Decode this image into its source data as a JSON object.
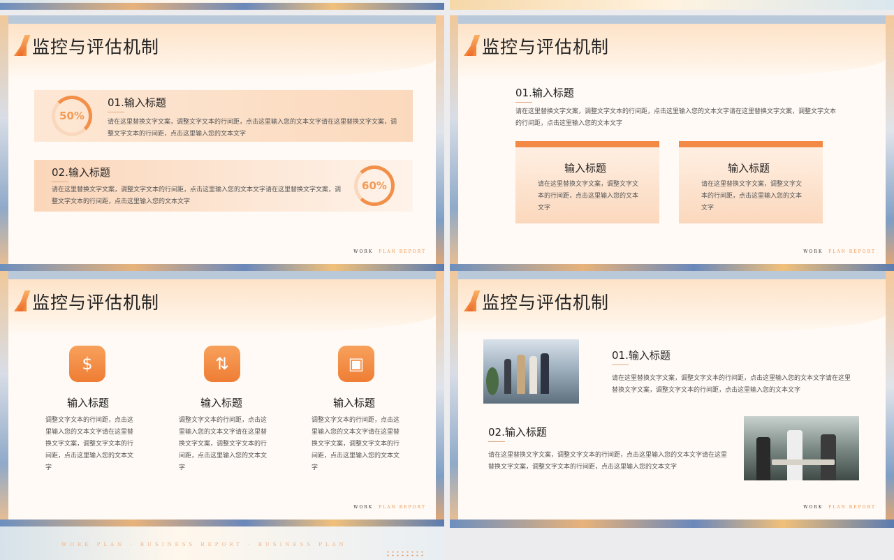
{
  "slide_title": "监控与评估机制",
  "footer": {
    "work": "WORK",
    "plan": "PLAN REPORT"
  },
  "slide1": {
    "items": [
      {
        "percent": "50%",
        "title": "01.输入标题",
        "text": "请在这里替换文字文案，调整文字文本的行间距，点击这里输入您的文本文字请在这里替换文字文案，调整文字文本的行间距，点击这里输入您的文本文字"
      },
      {
        "percent": "60%",
        "title": "02.输入标题",
        "text": "请在这里替换文字文案，调整文字文本的行间距，点击这里输入您的文本文字请在这里替换文字文案，调整文字文本的行间距，点击这里输入您的文本文字"
      }
    ]
  },
  "slide2": {
    "title": "01.输入标题",
    "text": "请在这里替换文字文案，调整文字文本的行间距，点击这里输入您的文本文字请在这里替换文字文案，调整文字文本的行间距，点击这里输入您的文本文字",
    "boxes": [
      {
        "title": "输入标题",
        "text": "请在这里替换文字文案，调整文字文本的行间距，点击这里输入您的文本文字"
      },
      {
        "title": "输入标题",
        "text": "请在这里替换文字文案，调整文字文本的行间距，点击这里输入您的文本文字"
      }
    ]
  },
  "slide3": {
    "columns": [
      {
        "icon": "receipt-icon",
        "title": "输入标题",
        "text": "调整文字文本的行间距，点击这里输入您的文本文字请在这里替换文字文案，调整文字文本的行间距，点击这里输入您的文本文字"
      },
      {
        "icon": "sliders-icon",
        "title": "输入标题",
        "text": "调整文字文本的行间距，点击这里输入您的文本文字请在这里替换文字文案，调整文字文本的行间距，点击这里输入您的文本文字"
      },
      {
        "icon": "box-icon",
        "title": "输入标题",
        "text": "调整文字文本的行间距，点击这里输入您的文本文字请在这里替换文字文案，调整文字文本的行间距，点击这里输入您的文本文字"
      }
    ]
  },
  "slide4": {
    "items": [
      {
        "title": "01.输入标题",
        "text": "请在这里替换文字文案，调整文字文本的行间距，点击这里输入您的文本文字请在这里替换文字文案，调整文字文本的行间距，点击这里输入您的文本文字"
      },
      {
        "title": "02.输入标题",
        "text": "请在这里替换文字文案，调整文字文本的行间距，点击这里输入您的文本文字请在这里替换文字文案，调整文字文本的行间距，点击这里输入您的文本文字"
      }
    ]
  },
  "strip_text": "WORK PLAN · BUSINESS REPORT · BUSINESS PLAN",
  "colors": {
    "accent": "#f28a45",
    "accent_light": "#fde3c8"
  }
}
